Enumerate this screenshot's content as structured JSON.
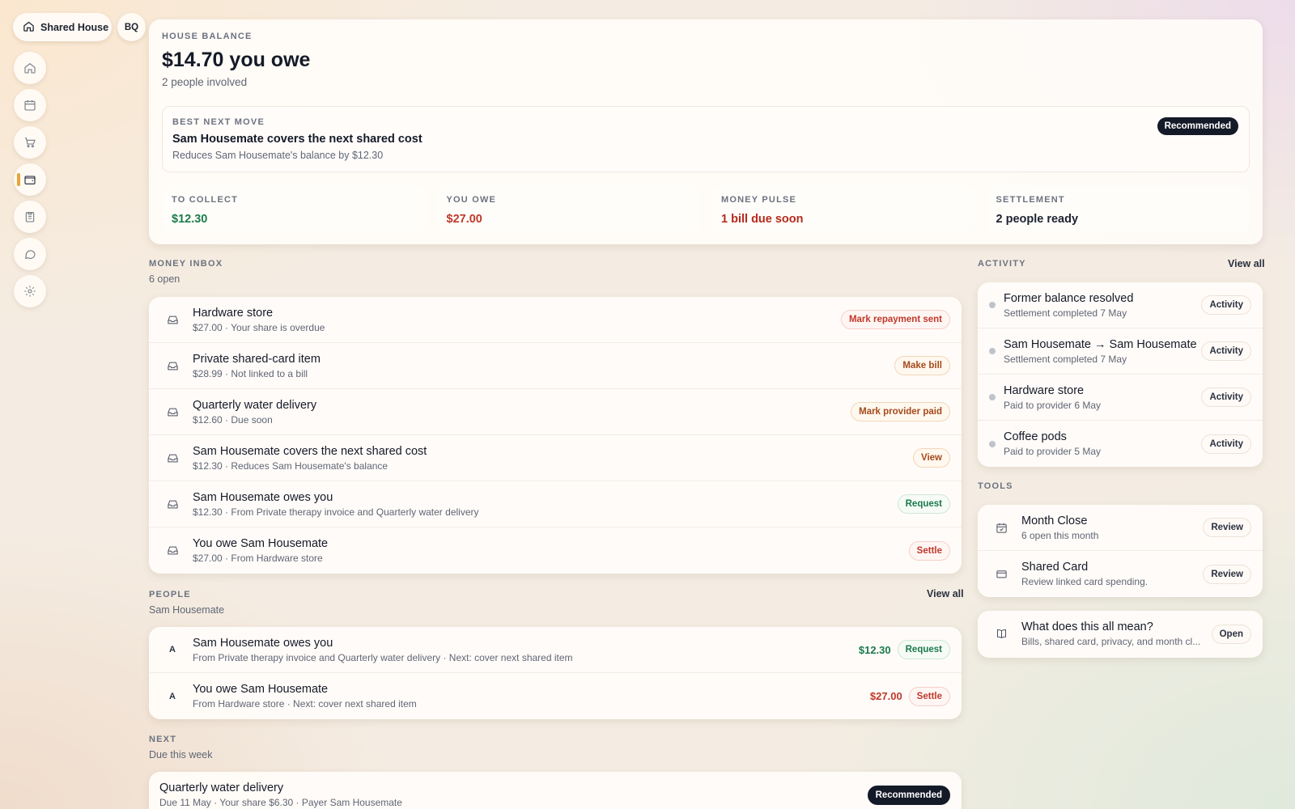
{
  "workspace": {
    "name": "Shared House",
    "initials": "BQ"
  },
  "nav": [
    {
      "icon": "home-icon"
    },
    {
      "icon": "calendar-icon"
    },
    {
      "icon": "cart-icon"
    },
    {
      "icon": "wallet-icon",
      "active": true
    },
    {
      "icon": "clipboard-icon"
    },
    {
      "icon": "chat-icon"
    },
    {
      "icon": "gear-icon"
    }
  ],
  "hero": {
    "eyebrow": "HOUSE BALANCE",
    "amount": "$14.70 you owe",
    "sub": "2 people involved",
    "next_move": {
      "eyebrow": "BEST NEXT MOVE",
      "title": "Sam Housemate covers the next shared cost",
      "desc": "Reduces Sam Housemate's balance by $12.30",
      "badge": "Recommended"
    },
    "metrics": [
      {
        "label": "TO COLLECT",
        "value": "$12.30",
        "color": "#1b7a4b"
      },
      {
        "label": "YOU OWE",
        "value": "$27.00",
        "color": "#c0392b"
      },
      {
        "label": "MONEY PULSE",
        "value": "1 bill due soon",
        "color": "#b52a1c"
      },
      {
        "label": "SETTLEMENT",
        "value": "2 people ready",
        "color": "#141a28"
      }
    ]
  },
  "inbox": {
    "eyebrow": "MONEY INBOX",
    "sub": "6 open",
    "items": [
      {
        "title": "Hardware store",
        "sub": "$27.00 · Your share is overdue",
        "action": "Mark repayment sent",
        "tone": "red"
      },
      {
        "title": "Private shared-card item",
        "sub": "$28.99 · Not linked to a bill",
        "action": "Make bill",
        "tone": "amber"
      },
      {
        "title": "Quarterly water delivery",
        "sub": "$12.60 · Due soon",
        "action": "Mark provider paid",
        "tone": "amber"
      },
      {
        "title": "Sam Housemate covers the next shared cost",
        "sub": "$12.30 · Reduces Sam Housemate's balance",
        "action": "View",
        "tone": "amber"
      },
      {
        "title": "Sam Housemate owes you",
        "sub": "$12.30 · From Private therapy invoice and Quarterly water delivery",
        "action": "Request",
        "tone": "green"
      },
      {
        "title": "You owe Sam Housemate",
        "sub": "$27.00 · From Hardware store",
        "action": "Settle",
        "tone": "red"
      }
    ]
  },
  "people": {
    "eyebrow": "PEOPLE",
    "sub": "Sam Housemate",
    "view_all": "View all",
    "items": [
      {
        "initial": "A",
        "title": "Sam Housemate owes you",
        "sub": "From Private therapy invoice and Quarterly water delivery · Next: cover next shared item",
        "amount": "$12.30",
        "amount_color": "#1b7a4b",
        "action": "Request",
        "tone": "green"
      },
      {
        "initial": "A",
        "title": "You owe Sam Housemate",
        "sub": "From Hardware store · Next: cover next shared item",
        "amount": "$27.00",
        "amount_color": "#c0392b",
        "action": "Settle",
        "tone": "red"
      }
    ]
  },
  "next": {
    "eyebrow": "NEXT",
    "sub": "Due this week",
    "items": [
      {
        "title": "Quarterly water delivery",
        "sub": "Due 11 May · Your share $6.30 · Payer Sam Housemate",
        "action": "Recommended",
        "tone": "dark"
      }
    ]
  },
  "activity": {
    "eyebrow": "ACTIVITY",
    "view_all": "View all",
    "items": [
      {
        "title": "Former balance resolved",
        "sub": "Settlement completed 7 May",
        "action": "Activity"
      },
      {
        "title": "Sam Housemate → Sam Housemate",
        "sub": "Settlement completed 7 May",
        "action": "Activity"
      },
      {
        "title": "Hardware store",
        "sub": "Paid to provider 6 May",
        "action": "Activity"
      },
      {
        "title": "Coffee pods",
        "sub": "Paid to provider 5 May",
        "action": "Activity"
      }
    ]
  },
  "tools": {
    "eyebrow": "TOOLS",
    "items": [
      {
        "icon": "calendar-check-icon",
        "title": "Month Close",
        "sub": "6 open this month",
        "action": "Review"
      },
      {
        "icon": "credit-card-icon",
        "title": "Shared Card",
        "sub": "Review linked card spending.",
        "action": "Review"
      }
    ]
  },
  "help": {
    "icon": "book-icon",
    "title": "What does this all mean?",
    "sub": "Bills, shared card, privacy, and month cl...",
    "action": "Open"
  }
}
